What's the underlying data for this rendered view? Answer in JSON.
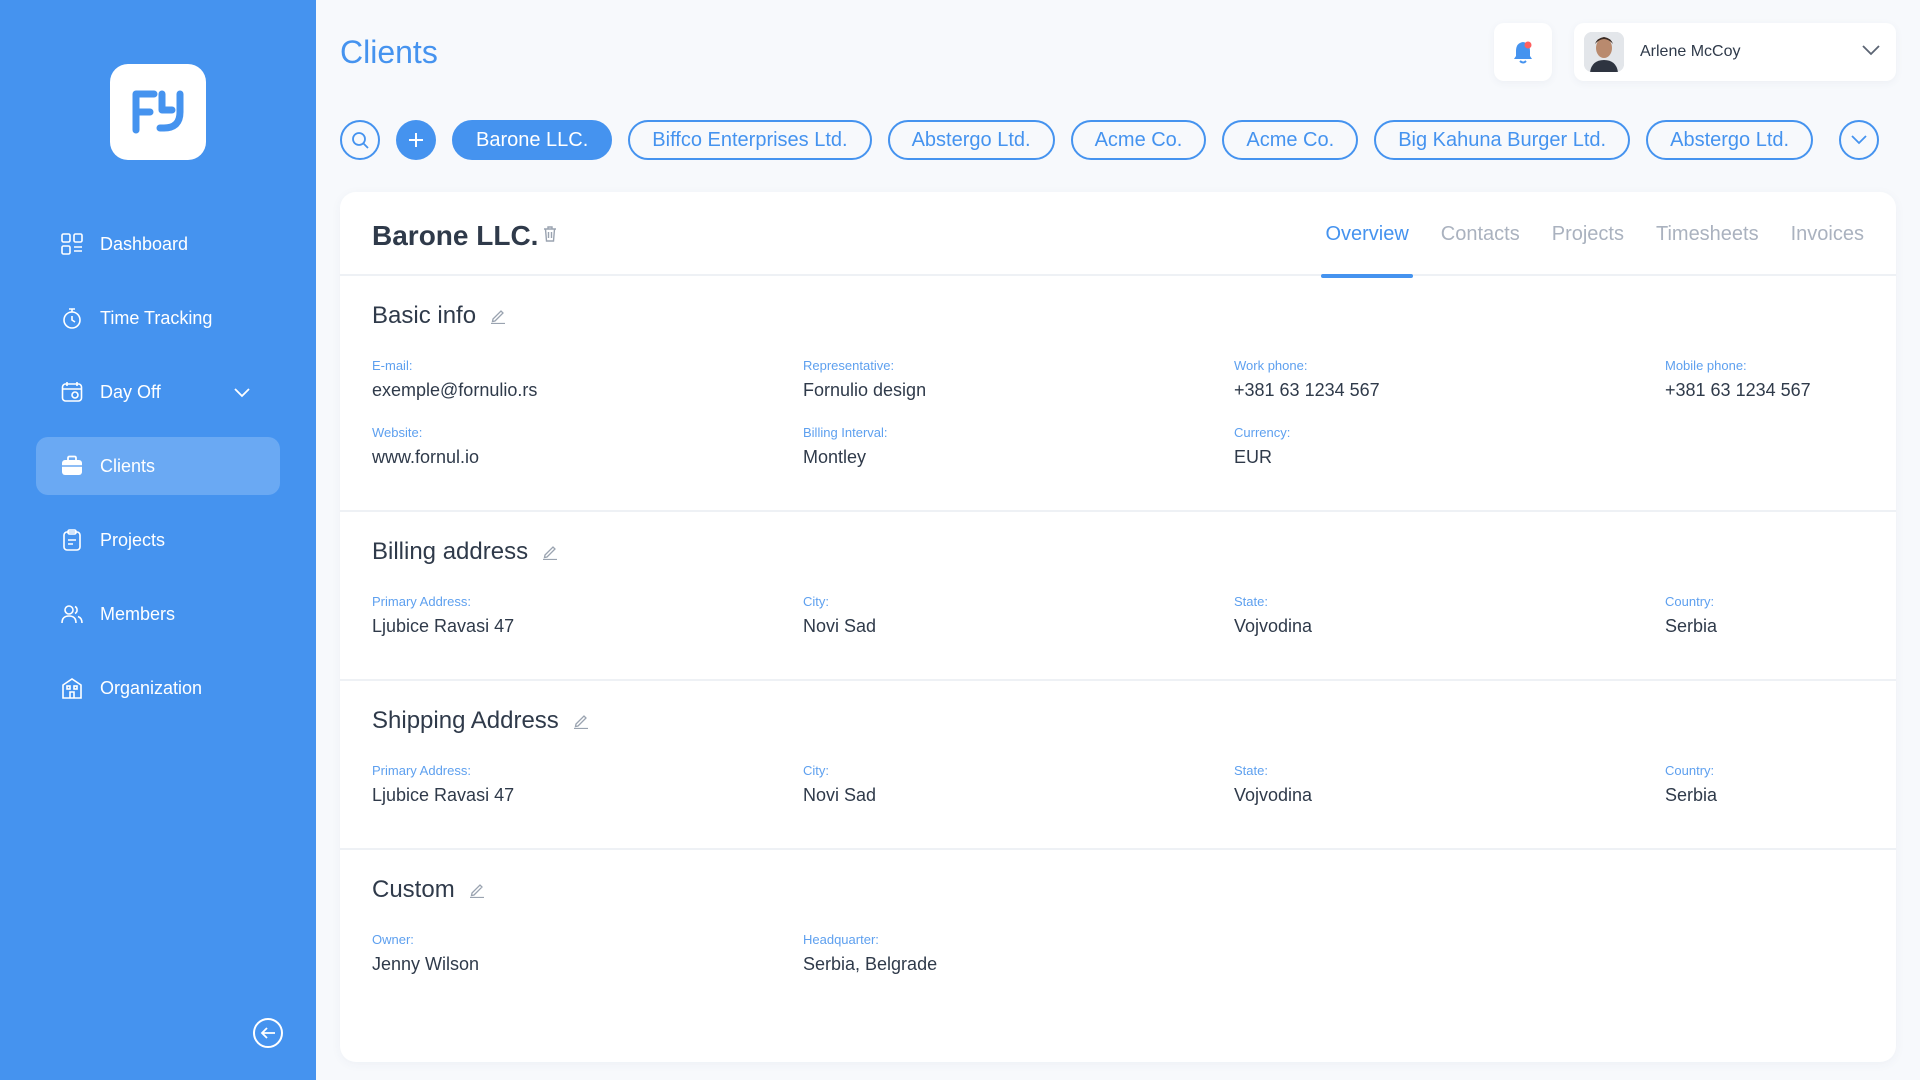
{
  "sidebar": {
    "items": [
      {
        "label": "Dashboard",
        "icon": "dashboard-icon"
      },
      {
        "label": "Time Tracking",
        "icon": "stopwatch-icon"
      },
      {
        "label": "Day Off",
        "icon": "calendar-icon"
      },
      {
        "label": "Clients",
        "icon": "briefcase-icon",
        "active": true
      },
      {
        "label": "Projects",
        "icon": "clipboard-icon"
      },
      {
        "label": "Members",
        "icon": "users-icon"
      },
      {
        "label": "Organization",
        "icon": "building-icon"
      }
    ]
  },
  "header": {
    "title": "Clients",
    "user_name": "Arlene McCoy"
  },
  "client_tabs": [
    "Barone LLC.",
    "Biffco Enterprises Ltd.",
    "Abstergo Ltd.",
    "Acme Co.",
    "Acme Co.",
    "Big Kahuna Burger Ltd.",
    "Abstergo Ltd."
  ],
  "client": {
    "name": "Barone LLC.",
    "tabs": [
      "Overview",
      "Contacts",
      "Projects",
      "Timesheets",
      "Invoices"
    ],
    "basic_info": {
      "title": "Basic info",
      "fields": [
        {
          "label": "E-mail:",
          "value": "exemple@fornulio.rs"
        },
        {
          "label": "Representative:",
          "value": "Fornulio design"
        },
        {
          "label": "Work phone:",
          "value": "+381 63 1234 567"
        },
        {
          "label": "Mobile phone:",
          "value": "+381 63 1234 567"
        },
        {
          "label": "Website:",
          "value": "www.fornul.io"
        },
        {
          "label": "Billing Interval:",
          "value": "Montley"
        },
        {
          "label": "Currency:",
          "value": "EUR"
        }
      ]
    },
    "billing_address": {
      "title": "Billing address",
      "fields": [
        {
          "label": "Primary Address:",
          "value": "Ljubice Ravasi 47"
        },
        {
          "label": "City:",
          "value": "Novi Sad"
        },
        {
          "label": "State:",
          "value": "Vojvodina"
        },
        {
          "label": "Country:",
          "value": "Serbia"
        }
      ]
    },
    "shipping_address": {
      "title": "Shipping Address",
      "fields": [
        {
          "label": "Primary Address:",
          "value": "Ljubice Ravasi 47"
        },
        {
          "label": "City:",
          "value": "Novi Sad"
        },
        {
          "label": "State:",
          "value": "Vojvodina"
        },
        {
          "label": "Country:",
          "value": "Serbia"
        }
      ]
    },
    "custom": {
      "title": "Custom",
      "fields": [
        {
          "label": "Owner:",
          "value": "Jenny Wilson"
        },
        {
          "label": "Headquarter:",
          "value": "Serbia, Belgrade"
        }
      ]
    }
  },
  "colors": {
    "accent": "#4593ef",
    "sidebar_bg": "#4593ef",
    "sidebar_active": "#6aa9f3",
    "label": "#5ea0ef",
    "text": "#2f3a4a",
    "muted_tab": "#aab2bf"
  }
}
